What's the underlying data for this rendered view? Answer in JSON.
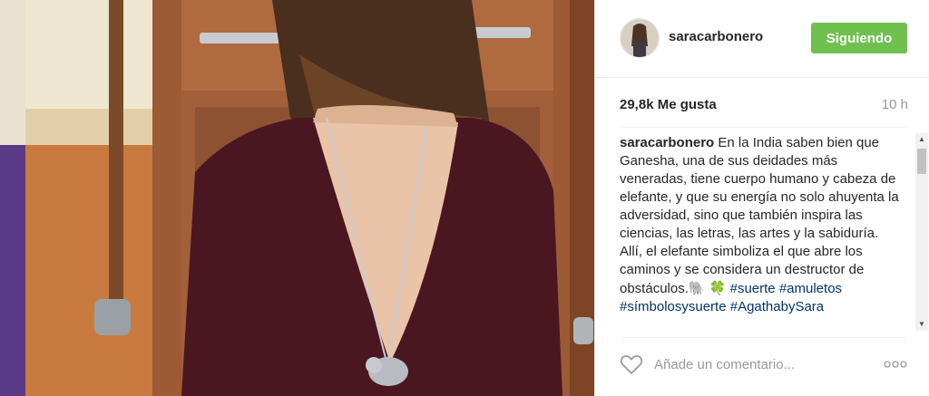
{
  "post": {
    "username": "saracarbonero",
    "follow_label": "Siguiendo",
    "likes": "29,8k Me gusta",
    "time_ago": "10 h"
  },
  "caption": {
    "username": "saracarbonero",
    "text": " En la India saben bien que Ganesha, una de sus deidades más veneradas, tiene cuerpo humano y cabeza de elefante, y que su energía no solo ahuyenta la adversidad, sino que también inspira las ciencias, las letras, las artes y la sabiduría.",
    "text2": "Allí, el elefante simboliza el que abre los caminos y se considera un destructor de obstáculos.",
    "emoji_elephant": "🐘",
    "emoji_clover": "🍀",
    "hashtags": [
      "#suerte",
      "#amuletos",
      "#símbolosysuerte",
      "#AgathabySara"
    ]
  },
  "comment": {
    "placeholder": "Añade un comentario..."
  },
  "icons": {
    "heart": "heart-icon",
    "more": "more-options-icon",
    "scroll_up": "scroll-up-arrow-icon",
    "scroll_down": "scroll-down-arrow-icon"
  },
  "colors": {
    "follow_button": "#70c050",
    "hashtag": "#003569",
    "text": "#262626",
    "muted": "#999999"
  }
}
